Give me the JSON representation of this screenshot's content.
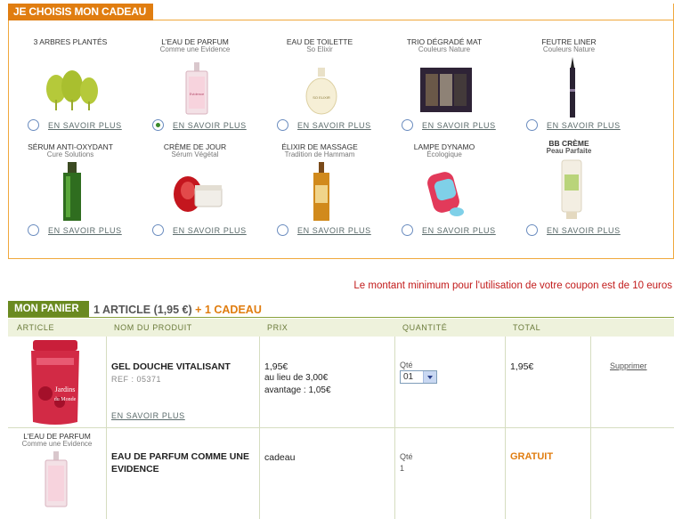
{
  "gift_section": {
    "title": "JE CHOISIS MON CADEAU",
    "more_label": "EN SAVOIR PLUS",
    "gifts": [
      {
        "name": "3 ARBRES PLANTÉS",
        "sub": "",
        "icon": "trees-icon",
        "selected": false
      },
      {
        "name": "L'EAU DE PARFUM",
        "sub": "Comme une Evidence",
        "icon": "perfume-bottle-icon",
        "selected": true
      },
      {
        "name": "EAU DE TOILETTE",
        "sub": "So Elixir",
        "icon": "toilette-bottle-icon",
        "selected": false
      },
      {
        "name": "TRIO DÉGRADÉ MAT",
        "sub": "Couleurs Nature",
        "icon": "eyeshadow-palette-icon",
        "selected": false
      },
      {
        "name": "FEUTRE LINER",
        "sub": "Couleurs Nature",
        "icon": "eyeliner-pen-icon",
        "selected": false
      },
      {
        "name": "SÉRUM ANTI-OXYDANT",
        "sub": "Cure Solutions",
        "icon": "serum-bottle-icon",
        "selected": false
      },
      {
        "name": "CRÈME DE JOUR",
        "sub": "Sérum Végétal",
        "icon": "cream-jar-icon",
        "selected": false
      },
      {
        "name": "ÉLIXIR DE MASSAGE",
        "sub": "Tradition de Hammam",
        "icon": "massage-oil-icon",
        "selected": false
      },
      {
        "name": "LAMPE DYNAMO",
        "sub": "Écologique",
        "icon": "dynamo-lamp-icon",
        "selected": false
      },
      {
        "name": "BB CRÈME",
        "sub": "Peau Parfaite",
        "icon": "bb-cream-tube-icon",
        "selected": false
      }
    ]
  },
  "coupon_message": "Le montant minimum pour l'utilisation de votre coupon est de 10 euros",
  "cart": {
    "tab_label": "MON PANIER",
    "summary": "1 ARTICLE (1,95 €)",
    "summary_gift": "+ 1 CADEAU",
    "headers": {
      "article": "ARTICLE",
      "product": "NOM DU PRODUIT",
      "price": "PRIX",
      "quantity": "QUANTITÉ",
      "total": "TOTAL"
    },
    "items": [
      {
        "image_label": "",
        "image_sub": "",
        "name": "GEL DOUCHE VITALISANT",
        "ref": "REF : 05371",
        "more": "EN SAVOIR PLUS",
        "price": "1,95€",
        "old_price": "au lieu de 3,00€",
        "saving": "avantage : 1,05€",
        "qty_label": "Qté",
        "qty": "01",
        "total": "1,95€",
        "remove": "Supprimer"
      },
      {
        "image_label": "L'EAU DE PARFUM",
        "image_sub": "Comme une Evidence",
        "name": "EAU DE PARFUM COMME UNE EVIDENCE",
        "price": "cadeau",
        "qty_label": "Qté",
        "qty": "1",
        "total": "GRATUIT"
      }
    ]
  },
  "colors": {
    "orange": "#e07d10",
    "green": "#6a8a20",
    "red": "#c21b1b"
  }
}
